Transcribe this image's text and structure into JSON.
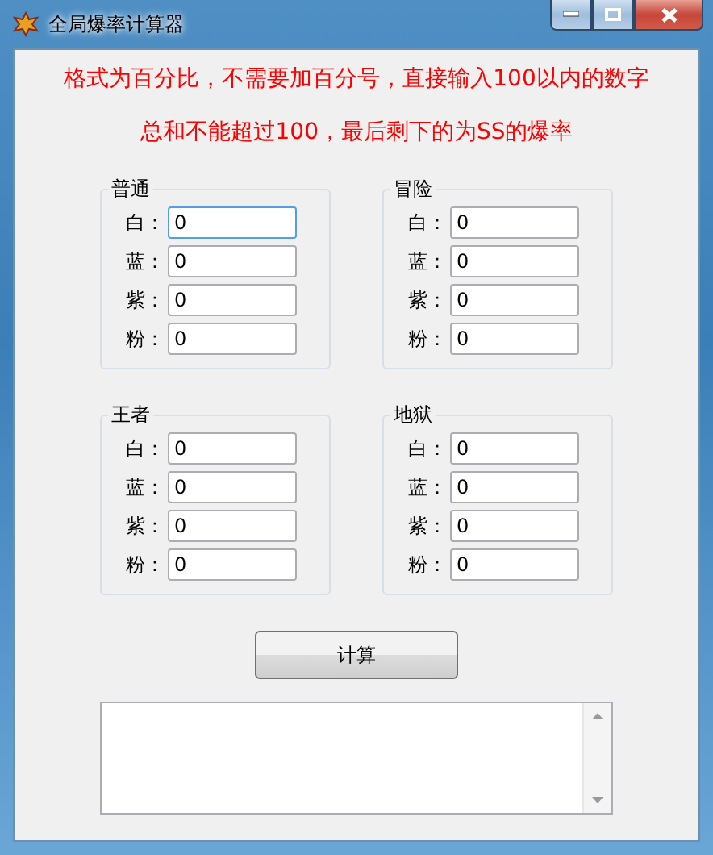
{
  "window": {
    "title": "全局爆率计算器"
  },
  "notice": [
    "格式为百分比，不需要加百分号，直接输入100以内的数字",
    "总和不能超过100，最后剩下的为SS的爆率"
  ],
  "groups": [
    {
      "title": "普通",
      "fields": [
        {
          "label": "白：",
          "value": "0",
          "focused": true
        },
        {
          "label": "蓝：",
          "value": "0",
          "focused": false
        },
        {
          "label": "紫：",
          "value": "0",
          "focused": false
        },
        {
          "label": "粉：",
          "value": "0",
          "focused": false
        }
      ]
    },
    {
      "title": "冒险",
      "fields": [
        {
          "label": "白：",
          "value": "0",
          "focused": false
        },
        {
          "label": "蓝：",
          "value": "0",
          "focused": false
        },
        {
          "label": "紫：",
          "value": "0",
          "focused": false
        },
        {
          "label": "粉：",
          "value": "0",
          "focused": false
        }
      ]
    },
    {
      "title": "王者",
      "fields": [
        {
          "label": "白：",
          "value": "0",
          "focused": false
        },
        {
          "label": "蓝：",
          "value": "0",
          "focused": false
        },
        {
          "label": "紫：",
          "value": "0",
          "focused": false
        },
        {
          "label": "粉：",
          "value": "0",
          "focused": false
        }
      ]
    },
    {
      "title": "地狱",
      "fields": [
        {
          "label": "白：",
          "value": "0",
          "focused": false
        },
        {
          "label": "蓝：",
          "value": "0",
          "focused": false
        },
        {
          "label": "紫：",
          "value": "0",
          "focused": false
        },
        {
          "label": "粉：",
          "value": "0",
          "focused": false
        }
      ]
    }
  ],
  "calculate_button": "计算"
}
